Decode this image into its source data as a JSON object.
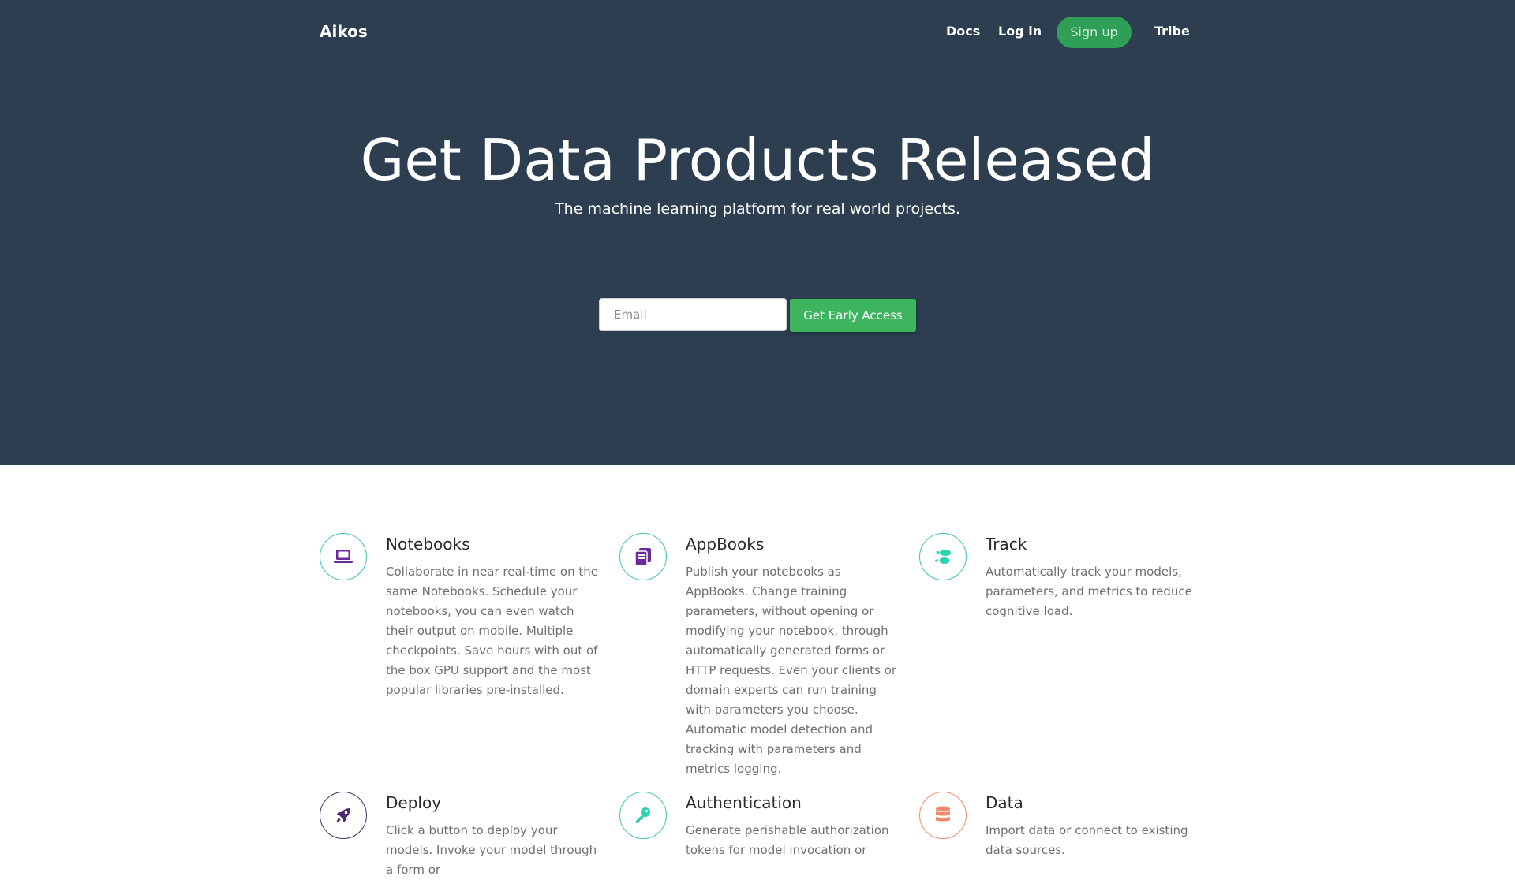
{
  "nav": {
    "brand": "Aikos",
    "docs": "Docs",
    "login": "Log in",
    "signup": "Sign up",
    "tribe": "Tribe"
  },
  "hero": {
    "title": "Get Data Products Released",
    "subtitle": "The machine learning platform for real world projects.",
    "email_placeholder": "Email",
    "cta_label": "Get Early Access"
  },
  "features": [
    {
      "title": "Notebooks",
      "description": "Collaborate in near real-time on the same Notebooks. Schedule your notebooks, you can even watch their output on mobile. Multiple checkpoints. Save hours with out of the box GPU support and the most popular libraries pre-installed.",
      "icon": "laptop-icon"
    },
    {
      "title": "AppBooks",
      "description": "Publish your notebooks as AppBooks. Change training parameters, without opening or modifying your notebook, through automatically generated forms or HTTP requests. Even your clients or domain experts can run training with parameters you choose. Automatic model detection and tracking with parameters and metrics logging.",
      "icon": "stacked-pages-icon"
    },
    {
      "title": "Track",
      "description": "Automatically track your models, parameters, and metrics to reduce cognitive load.",
      "icon": "footprints-icon"
    },
    {
      "title": "Deploy",
      "description": "Click a button to deploy your models. Invoke your model through a form or",
      "icon": "rocket-icon"
    },
    {
      "title": "Authentication",
      "description": "Generate perishable authorization tokens for model invocation or",
      "icon": "key-icon"
    },
    {
      "title": "Data",
      "description": "Import data or connect to existing data sources.",
      "icon": "database-icon"
    }
  ],
  "colors": {
    "hero_bg": "#2c3e50",
    "signup_bg": "#2f9e56",
    "cta_bg": "#3cb55e",
    "icon_ring": "#3fc4b4",
    "purple": "#6a2a9e",
    "teal": "#2ed3b4",
    "coral": "#f28b6b"
  }
}
